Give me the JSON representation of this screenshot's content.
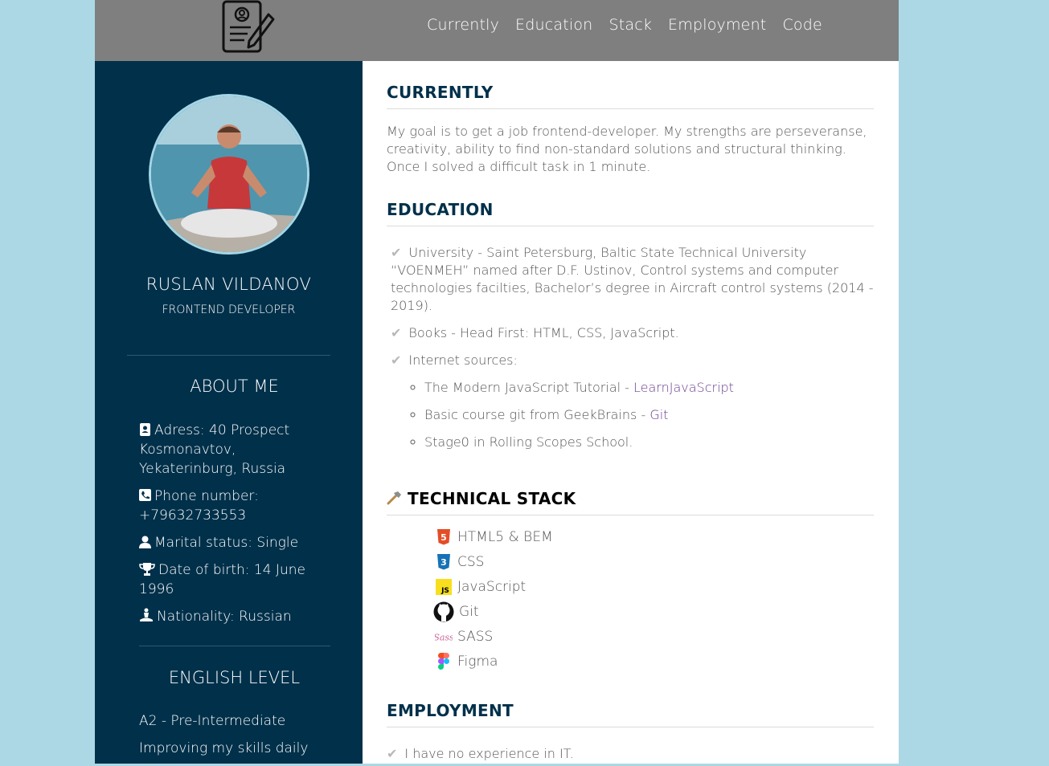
{
  "nav": {
    "items": [
      "Currently",
      "Education",
      "Stack",
      "Employment",
      "Code"
    ]
  },
  "profile": {
    "name": "RUSLAN VILDANOV",
    "role": "FRONTEND DEVELOPER"
  },
  "about": {
    "title": "ABOUT ME",
    "items": [
      {
        "icon": "address-book-icon",
        "text": "Adress: 40 Prospect Kosmonavtov, Yekaterinburg, Russia"
      },
      {
        "icon": "phone-icon",
        "text": "Phone number: +79632733553"
      },
      {
        "icon": "user-icon",
        "text": "Marital status: Single"
      },
      {
        "icon": "trophy-icon",
        "text": "Date of birth: 14 June 1996"
      },
      {
        "icon": "meditation-icon",
        "text": "Nationality: Russian"
      }
    ]
  },
  "english": {
    "title": "ENGLISH LEVEL",
    "items": [
      "A2 - Pre-Intermediate",
      "Improving my skills daily"
    ]
  },
  "currently": {
    "title": "CURRENTLY",
    "text": "My goal is to get a job frontend-developer. My strengths are perseveranse, creativity, ability to find non-standard solutions and structural thinking. Once I solved a difficult task in 1 minute."
  },
  "education": {
    "title": "EDUCATION",
    "items": [
      "University - Saint Petersburg, Baltic State Technical University “VOENMEH” named after D.F. Ustinov, Control systems and computer technologies facilties, Bachelor’s degree in Aircraft control systems (2014 - 2019).",
      "Books - Head First: HTML, CSS, JavaScript.",
      "Internet sources:"
    ],
    "sources": [
      {
        "text": "The Modern JavaScript Tutorial - ",
        "link": "LearnJavaScript"
      },
      {
        "text": "Basic course git from GeekBrains - ",
        "link": "Git"
      },
      {
        "text": "Stage0 in Rolling Scopes School.",
        "link": ""
      }
    ]
  },
  "stack": {
    "title": "TECHNICAL STACK",
    "items": [
      {
        "icon": "html5-icon",
        "label": "HTML5 & BEM"
      },
      {
        "icon": "css3-icon",
        "label": "CSS"
      },
      {
        "icon": "javascript-icon",
        "label": "JavaScript"
      },
      {
        "icon": "github-icon",
        "label": "Git"
      },
      {
        "icon": "sass-icon",
        "label": "SASS"
      },
      {
        "icon": "figma-icon",
        "label": "Figma"
      }
    ]
  },
  "employment": {
    "title": "EMPLOYMENT",
    "items": [
      "I have no experience in IT."
    ]
  },
  "colors": {
    "header": "#7f7f7f",
    "sidebar": "#00304a",
    "background": "#acd8e6",
    "link": "#6a3d8e"
  }
}
